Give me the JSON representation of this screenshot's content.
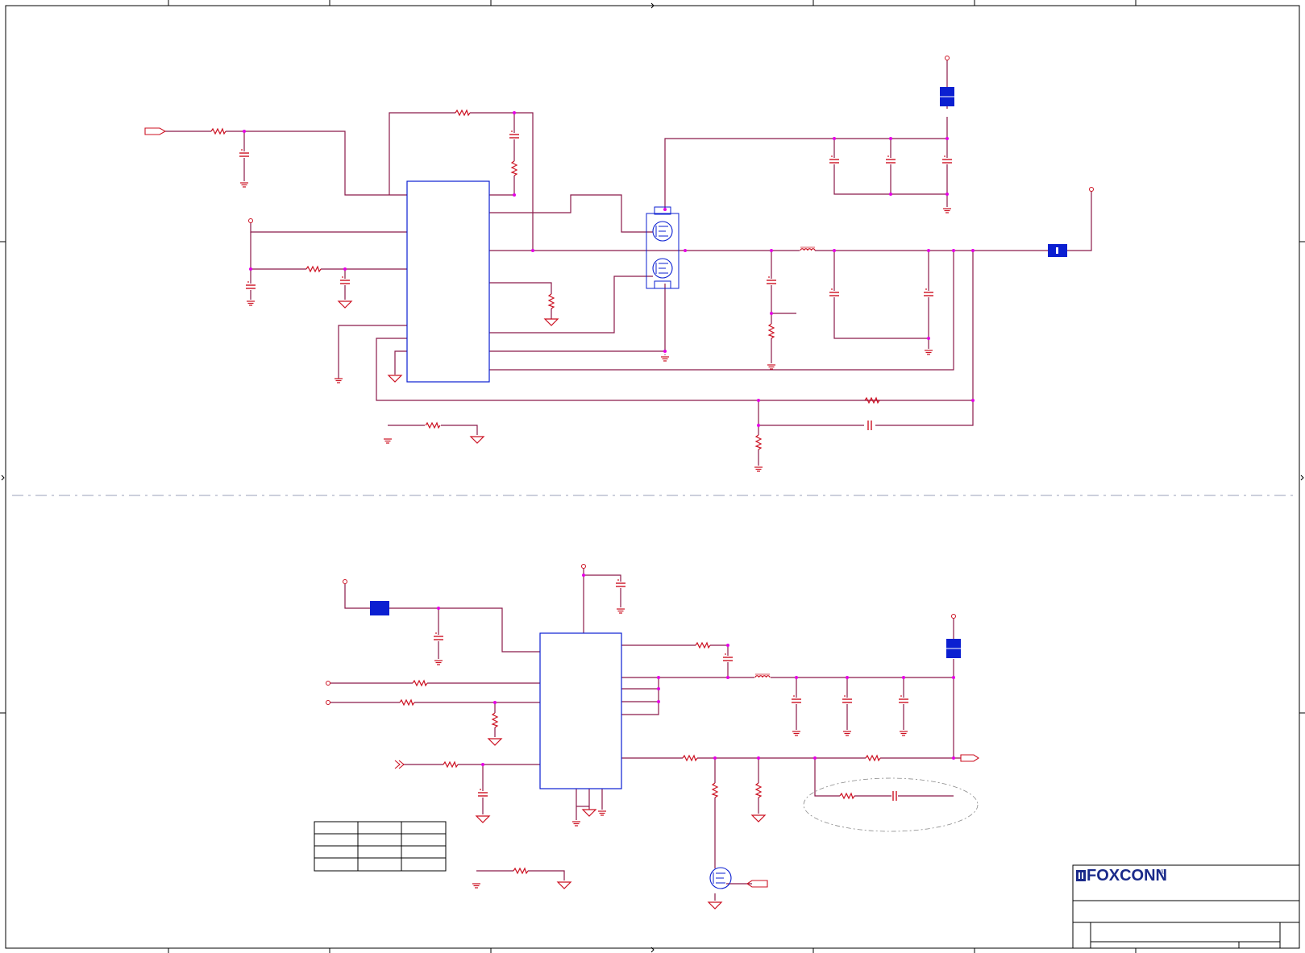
{
  "diagram": {
    "type": "schematic",
    "title_block": {
      "logo_text": "FOXCONN",
      "registered_mark": "®"
    }
  },
  "colors": {
    "wire": "#8b1a4a",
    "component": "#cc1122",
    "junction": "#e600e6",
    "module_fill": "#0b1fd1",
    "border": "#000000",
    "logo": "#1a2a8a"
  },
  "icons": {
    "resistor": "resistor-icon",
    "capacitor": "capacitor-icon",
    "ground": "ground-icon",
    "mosfet": "mosfet-icon",
    "inductor": "inductor-icon",
    "connector": "connector-icon",
    "controller": "controller-ic-icon"
  }
}
